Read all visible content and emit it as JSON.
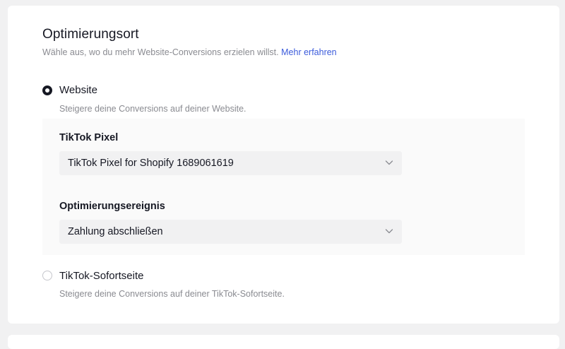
{
  "section": {
    "title": "Optimierungsort",
    "subtitle": "Wähle aus, wo du mehr Website-Conversions erzielen willst.",
    "learn_more": "Mehr erfahren"
  },
  "options": [
    {
      "label": "Website",
      "description": "Steigere deine Conversions auf deiner Website.",
      "selected": true
    },
    {
      "label": "TikTok-Sofortseite",
      "description": "Steigere deine Conversions auf deiner TikTok-Sofortseite.",
      "selected": false
    }
  ],
  "pixel": {
    "label": "TikTok Pixel",
    "value": "TikTok Pixel for Shopify 1689061619"
  },
  "event": {
    "label": "Optimierungsereignis",
    "value": "Zahlung abschließen"
  },
  "icons": {
    "dropdown": "chevron-down-icon"
  }
}
